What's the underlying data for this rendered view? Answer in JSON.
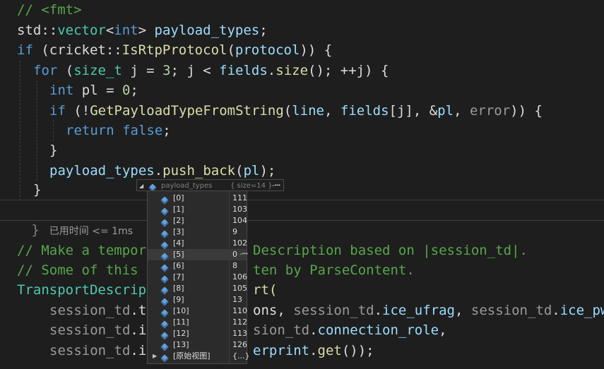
{
  "code": {
    "line_fmt_comment": "// <fmt>",
    "line_vector": {
      "ns": "std::",
      "type": "vector",
      "lt": "<",
      "elem_type": "int",
      "gt": ">",
      "var": "payload_types",
      "end": ";"
    },
    "line_if": {
      "kw": "if",
      "open": " (",
      "ns": "cricket::",
      "fn": "IsRtpProtocol",
      "p_open": "(",
      "arg": "protocol",
      "tail": ")) {"
    },
    "line_for": {
      "kw": "for",
      "open": " (",
      "type": "size_t",
      "rest1": " j = ",
      "num3": "3",
      "rest2": "; j < ",
      "var": "fields",
      "dot": ".",
      "fn": "size",
      "tail": "(); ++j) {"
    },
    "line_int": {
      "kw": "int",
      "rest": " pl = ",
      "num": "0",
      "end": ";"
    },
    "line_if2": {
      "kw": "if",
      "open": " (!",
      "fn": "GetPayloadTypeFromString",
      "p_open": "(",
      "a1": "line",
      "c1": ", ",
      "a2": "fields",
      "idx": "[j]",
      "c2": ", &",
      "a3": "pl",
      "c3": ", ",
      "a4": "error",
      "tail": ")) {"
    },
    "line_return": {
      "kw": "return",
      "sp": " ",
      "val": "false",
      "end": ";"
    },
    "line_close_if2": "}",
    "line_push": {
      "var": "payload_types",
      "dot": ".",
      "fn": "push_back",
      "p_open": "(",
      "arg": "pl",
      "tail": ");"
    },
    "line_close_for": "}",
    "line_close_if_brace": "}",
    "perf_tip": "已用时间 <= 1ms",
    "line_comment1_a": "// Make a tempor",
    "line_comment1_b": "Description based on |session_td|.",
    "line_comment2_a": "// Some of this",
    "line_comment2_b": "ten by ParseContent.",
    "line_transport_a": "TransportDescrip",
    "line_transport_b": "rt(",
    "line_st1": {
      "a_var": "session_td",
      "a_dot": ".",
      "a_tail": "t",
      "b": "ons, ",
      "c_var": "session_td",
      "c_dot": ".",
      "c_fn": "ice_ufrag",
      "d": ", ",
      "e_var": "session_td",
      "e_dot": ".",
      "e_fn": "ice_pw"
    },
    "line_st2": {
      "a_var": "session_td",
      "a_dot": ".",
      "a_tail": "i",
      "b_var": "sion_td",
      "b_dot": ".",
      "b_fn": "connection_role",
      "end": ","
    },
    "line_st3": {
      "a_var": "session_td",
      "a_dot": ".",
      "a_tail": "i",
      "b_fn": "erprint",
      "b_dot": ".",
      "c_fn": "get",
      "end": "());"
    }
  },
  "datatip": {
    "header_name": "payload_types",
    "header_value": "{ size=14 }",
    "pin_glyph": "-ꟷ",
    "items": [
      {
        "name": "[0]",
        "value": "111"
      },
      {
        "name": "[1]",
        "value": "103"
      },
      {
        "name": "[2]",
        "value": "104"
      },
      {
        "name": "[3]",
        "value": "9"
      },
      {
        "name": "[4]",
        "value": "102"
      },
      {
        "name": "[5]",
        "value": "0"
      },
      {
        "name": "[6]",
        "value": "8"
      },
      {
        "name": "[7]",
        "value": "106"
      },
      {
        "name": "[8]",
        "value": "105"
      },
      {
        "name": "[9]",
        "value": "13"
      },
      {
        "name": "[10]",
        "value": "110"
      },
      {
        "name": "[11]",
        "value": "112"
      },
      {
        "name": "[12]",
        "value": "113"
      },
      {
        "name": "[13]",
        "value": "126"
      }
    ],
    "raw_view_name": "[原始视图]",
    "raw_view_value": "{...}"
  },
  "colors": {
    "background": "#1e1e1e",
    "comment": "#57a64a",
    "keyword": "#569cd6",
    "type": "#4ec9b0",
    "function": "#dcdcaa",
    "variable": "#9cdcfe",
    "number": "#b5cea8",
    "icon": "#64a0dc"
  },
  "icons": {
    "variable": "cube-icon",
    "expand": "triangle-right-icon",
    "pin": "pin-icon"
  }
}
